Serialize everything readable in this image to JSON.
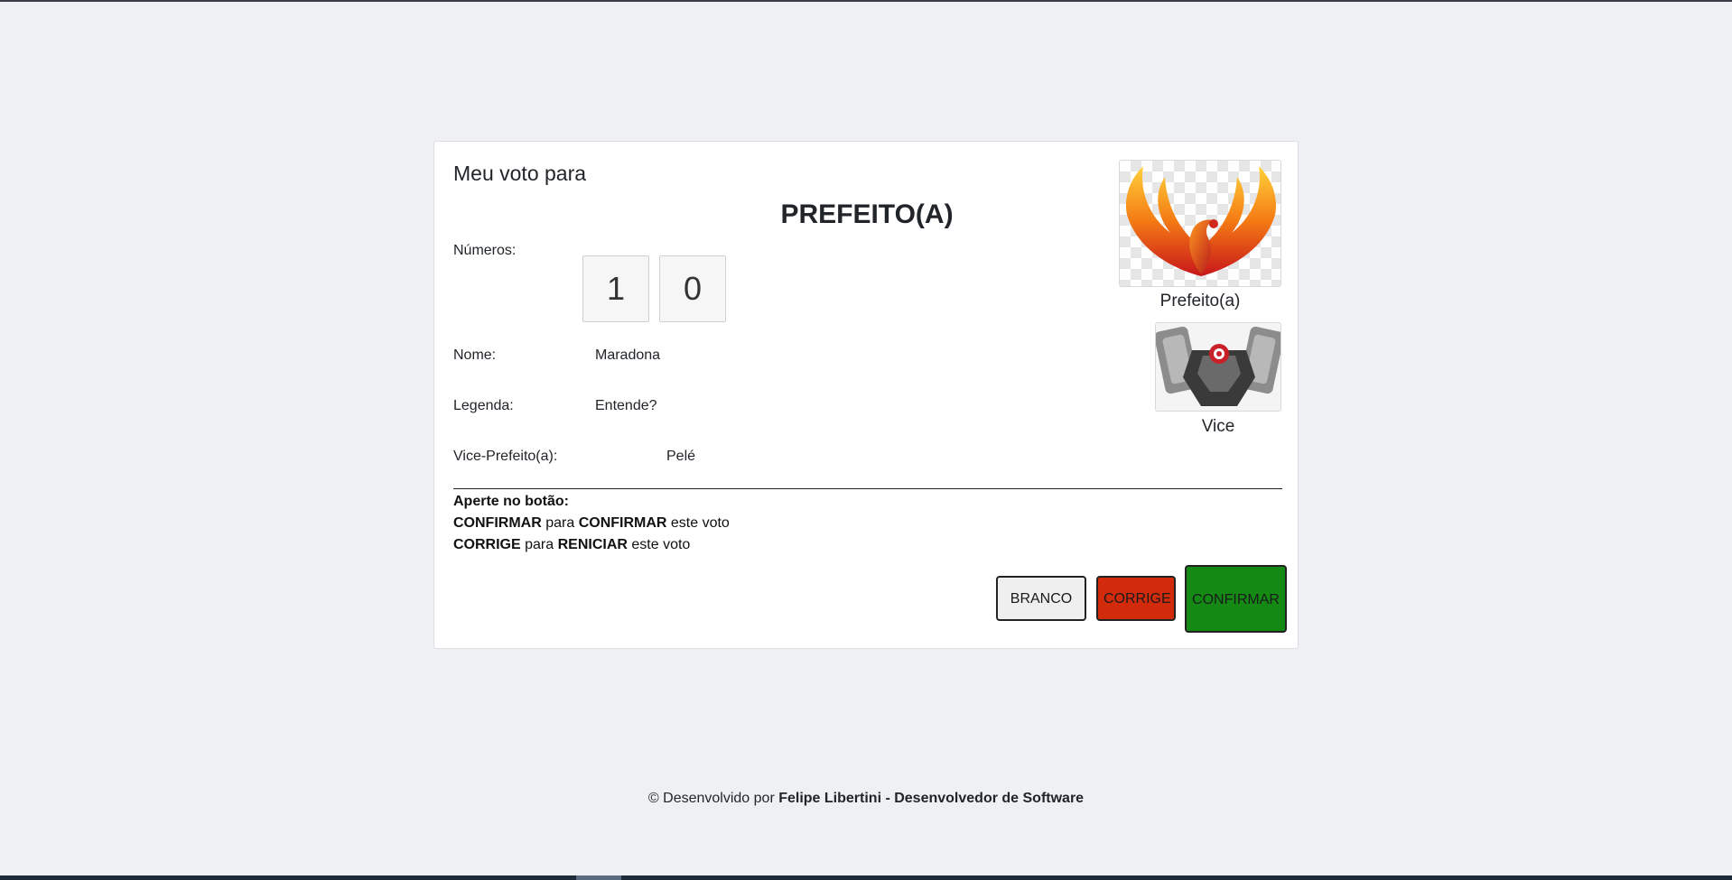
{
  "ballot": {
    "heading": "Meu voto para",
    "office": "PREFEITO(A)",
    "numbers_label": "Números:",
    "digits": [
      "1",
      "0"
    ],
    "name_label": "Nome:",
    "name_value": "Maradona",
    "party_label": "Legenda:",
    "party_value": "Entende?",
    "vice_label": "Vice-Prefeito(a):",
    "vice_value": "Pelé"
  },
  "photos": {
    "mayor_caption": "Prefeito(a)",
    "mayor_icon": "phoenix-logo",
    "vice_caption": "Vice",
    "vice_icon": "robot-mech-emblem"
  },
  "instructions": {
    "line1": "Aperte no botão:",
    "line2_a": "CONFIRMAR",
    "line2_b": " para ",
    "line2_c": "CONFIRMAR",
    "line2_d": " este voto",
    "line3_a": "CORRIGE",
    "line3_b": " para ",
    "line3_c": "RENICIAR",
    "line3_d": " este voto"
  },
  "buttons": {
    "blank": "BRANCO",
    "correct": "CORRIGE",
    "confirm": "CONFIRMAR",
    "blank_color": "#efefef",
    "correct_color": "#d22b0c",
    "confirm_color": "#148a14"
  },
  "footer": {
    "prefix": "© Desenvolvido por ",
    "author": "Felipe Libertini - Desenvolvedor de Software"
  }
}
